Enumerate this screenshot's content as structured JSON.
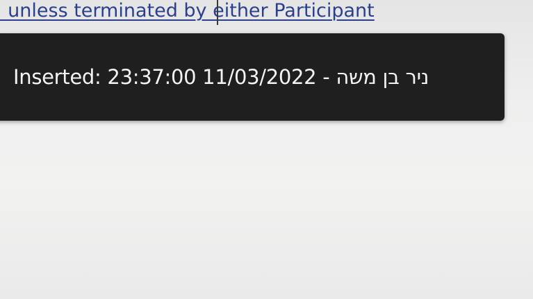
{
  "document": {
    "visible_line": ", unless terminated by either Participant"
  },
  "tooltip": {
    "text": "Inserted: 23:37:00 11/03/2022 - ניר בן משה"
  }
}
